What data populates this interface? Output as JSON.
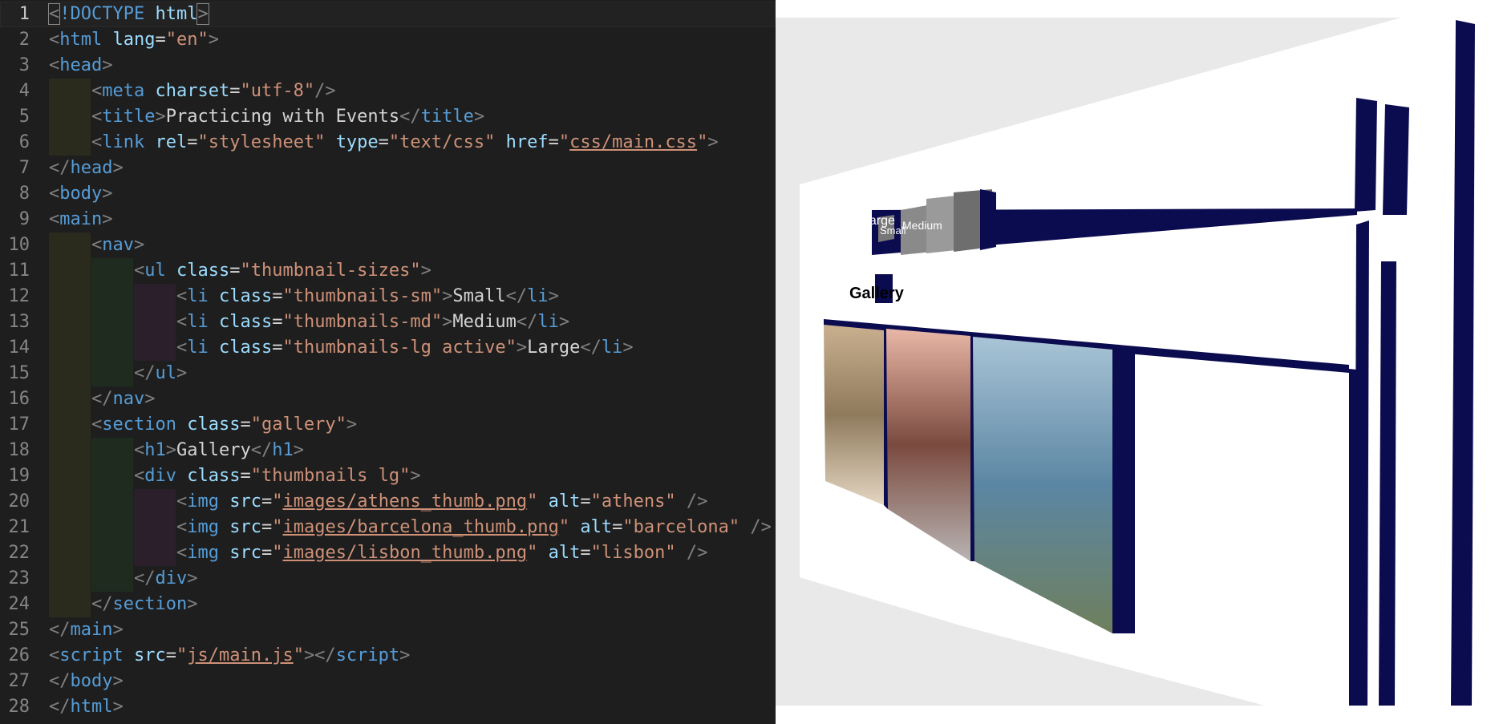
{
  "editor": {
    "current_line": 1,
    "lines": [
      {
        "n": "1",
        "indent": 0,
        "tokens": [
          [
            "br",
            "<"
          ],
          [
            "tag",
            "!DOCTYPE"
          ],
          [
            "text",
            " "
          ],
          [
            "attr",
            "html"
          ],
          [
            "br",
            ">"
          ]
        ]
      },
      {
        "n": "2",
        "indent": 0,
        "tokens": [
          [
            "br",
            "<"
          ],
          [
            "tag",
            "html"
          ],
          [
            "text",
            " "
          ],
          [
            "attr",
            "lang"
          ],
          [
            "eq",
            "="
          ],
          [
            "str",
            "\"en\""
          ],
          [
            "br",
            ">"
          ]
        ]
      },
      {
        "n": "3",
        "indent": 0,
        "tokens": [
          [
            "br",
            "<"
          ],
          [
            "tag",
            "head"
          ],
          [
            "br",
            ">"
          ]
        ]
      },
      {
        "n": "4",
        "indent": 1,
        "tokens": [
          [
            "br",
            "<"
          ],
          [
            "tag",
            "meta"
          ],
          [
            "text",
            " "
          ],
          [
            "attr",
            "charset"
          ],
          [
            "eq",
            "="
          ],
          [
            "str",
            "\"utf-8\""
          ],
          [
            "br",
            "/>"
          ]
        ]
      },
      {
        "n": "5",
        "indent": 1,
        "tokens": [
          [
            "br",
            "<"
          ],
          [
            "tag",
            "title"
          ],
          [
            "br",
            ">"
          ],
          [
            "text",
            "Practicing with Events"
          ],
          [
            "br",
            "</"
          ],
          [
            "tag",
            "title"
          ],
          [
            "br",
            ">"
          ]
        ]
      },
      {
        "n": "6",
        "indent": 1,
        "tokens": [
          [
            "br",
            "<"
          ],
          [
            "tag",
            "link"
          ],
          [
            "text",
            " "
          ],
          [
            "attr",
            "rel"
          ],
          [
            "eq",
            "="
          ],
          [
            "str",
            "\"stylesheet\""
          ],
          [
            "text",
            " "
          ],
          [
            "attr",
            "type"
          ],
          [
            "eq",
            "="
          ],
          [
            "str",
            "\"text/css\""
          ],
          [
            "text",
            " "
          ],
          [
            "attr",
            "href"
          ],
          [
            "eq",
            "="
          ],
          [
            "str",
            "\""
          ],
          [
            "link",
            "css/main.css"
          ],
          [
            "str",
            "\""
          ],
          [
            "br",
            ">"
          ]
        ]
      },
      {
        "n": "7",
        "indent": 0,
        "tokens": [
          [
            "br",
            "</"
          ],
          [
            "tag",
            "head"
          ],
          [
            "br",
            ">"
          ]
        ]
      },
      {
        "n": "8",
        "indent": 0,
        "tokens": [
          [
            "br",
            "<"
          ],
          [
            "tag",
            "body"
          ],
          [
            "br",
            ">"
          ]
        ]
      },
      {
        "n": "9",
        "indent": 0,
        "tokens": [
          [
            "br",
            "<"
          ],
          [
            "tag",
            "main"
          ],
          [
            "br",
            ">"
          ]
        ]
      },
      {
        "n": "10",
        "indent": 1,
        "tokens": [
          [
            "br",
            "<"
          ],
          [
            "tag",
            "nav"
          ],
          [
            "br",
            ">"
          ]
        ]
      },
      {
        "n": "11",
        "indent": 2,
        "tokens": [
          [
            "br",
            "<"
          ],
          [
            "tag",
            "ul"
          ],
          [
            "text",
            " "
          ],
          [
            "attr",
            "class"
          ],
          [
            "eq",
            "="
          ],
          [
            "str",
            "\"thumbnail-sizes\""
          ],
          [
            "br",
            ">"
          ]
        ]
      },
      {
        "n": "12",
        "indent": 3,
        "tokens": [
          [
            "br",
            "<"
          ],
          [
            "tag",
            "li"
          ],
          [
            "text",
            " "
          ],
          [
            "attr",
            "class"
          ],
          [
            "eq",
            "="
          ],
          [
            "str",
            "\"thumbnails-sm\""
          ],
          [
            "br",
            ">"
          ],
          [
            "text",
            "Small"
          ],
          [
            "br",
            "</"
          ],
          [
            "tag",
            "li"
          ],
          [
            "br",
            ">"
          ]
        ]
      },
      {
        "n": "13",
        "indent": 3,
        "tokens": [
          [
            "br",
            "<"
          ],
          [
            "tag",
            "li"
          ],
          [
            "text",
            " "
          ],
          [
            "attr",
            "class"
          ],
          [
            "eq",
            "="
          ],
          [
            "str",
            "\"thumbnails-md\""
          ],
          [
            "br",
            ">"
          ],
          [
            "text",
            "Medium"
          ],
          [
            "br",
            "</"
          ],
          [
            "tag",
            "li"
          ],
          [
            "br",
            ">"
          ]
        ]
      },
      {
        "n": "14",
        "indent": 3,
        "tokens": [
          [
            "br",
            "<"
          ],
          [
            "tag",
            "li"
          ],
          [
            "text",
            " "
          ],
          [
            "attr",
            "class"
          ],
          [
            "eq",
            "="
          ],
          [
            "str",
            "\"thumbnails-lg active\""
          ],
          [
            "br",
            ">"
          ],
          [
            "text",
            "Large"
          ],
          [
            "br",
            "</"
          ],
          [
            "tag",
            "li"
          ],
          [
            "br",
            ">"
          ]
        ]
      },
      {
        "n": "15",
        "indent": 2,
        "tokens": [
          [
            "br",
            "</"
          ],
          [
            "tag",
            "ul"
          ],
          [
            "br",
            ">"
          ]
        ]
      },
      {
        "n": "16",
        "indent": 1,
        "tokens": [
          [
            "br",
            "</"
          ],
          [
            "tag",
            "nav"
          ],
          [
            "br",
            ">"
          ]
        ]
      },
      {
        "n": "17",
        "indent": 1,
        "tokens": [
          [
            "br",
            "<"
          ],
          [
            "tag",
            "section"
          ],
          [
            "text",
            " "
          ],
          [
            "attr",
            "class"
          ],
          [
            "eq",
            "="
          ],
          [
            "str",
            "\"gallery\""
          ],
          [
            "br",
            ">"
          ]
        ]
      },
      {
        "n": "18",
        "indent": 2,
        "tokens": [
          [
            "br",
            "<"
          ],
          [
            "tag",
            "h1"
          ],
          [
            "br",
            ">"
          ],
          [
            "text",
            "Gallery"
          ],
          [
            "br",
            "</"
          ],
          [
            "tag",
            "h1"
          ],
          [
            "br",
            ">"
          ]
        ]
      },
      {
        "n": "19",
        "indent": 2,
        "tokens": [
          [
            "br",
            "<"
          ],
          [
            "tag",
            "div"
          ],
          [
            "text",
            " "
          ],
          [
            "attr",
            "class"
          ],
          [
            "eq",
            "="
          ],
          [
            "str",
            "\"thumbnails lg\""
          ],
          [
            "br",
            ">"
          ]
        ]
      },
      {
        "n": "20",
        "indent": 3,
        "tokens": [
          [
            "br",
            "<"
          ],
          [
            "tag",
            "img"
          ],
          [
            "text",
            " "
          ],
          [
            "attr",
            "src"
          ],
          [
            "eq",
            "="
          ],
          [
            "str",
            "\""
          ],
          [
            "link",
            "images/athens_thumb.png"
          ],
          [
            "str",
            "\""
          ],
          [
            "text",
            " "
          ],
          [
            "attr",
            "alt"
          ],
          [
            "eq",
            "="
          ],
          [
            "str",
            "\"athens\""
          ],
          [
            "text",
            " "
          ],
          [
            "br",
            "/>"
          ]
        ]
      },
      {
        "n": "21",
        "indent": 3,
        "tokens": [
          [
            "br",
            "<"
          ],
          [
            "tag",
            "img"
          ],
          [
            "text",
            " "
          ],
          [
            "attr",
            "src"
          ],
          [
            "eq",
            "="
          ],
          [
            "str",
            "\""
          ],
          [
            "link",
            "images/barcelona_thumb.png"
          ],
          [
            "str",
            "\""
          ],
          [
            "text",
            " "
          ],
          [
            "attr",
            "alt"
          ],
          [
            "eq",
            "="
          ],
          [
            "str",
            "\"barcelona\""
          ],
          [
            "text",
            " "
          ],
          [
            "br",
            "/>"
          ]
        ]
      },
      {
        "n": "22",
        "indent": 3,
        "tokens": [
          [
            "br",
            "<"
          ],
          [
            "tag",
            "img"
          ],
          [
            "text",
            " "
          ],
          [
            "attr",
            "src"
          ],
          [
            "eq",
            "="
          ],
          [
            "str",
            "\""
          ],
          [
            "link",
            "images/lisbon_thumb.png"
          ],
          [
            "str",
            "\""
          ],
          [
            "text",
            " "
          ],
          [
            "attr",
            "alt"
          ],
          [
            "eq",
            "="
          ],
          [
            "str",
            "\"lisbon\""
          ],
          [
            "text",
            " "
          ],
          [
            "br",
            "/>"
          ]
        ]
      },
      {
        "n": "23",
        "indent": 2,
        "tokens": [
          [
            "br",
            "</"
          ],
          [
            "tag",
            "div"
          ],
          [
            "br",
            ">"
          ]
        ]
      },
      {
        "n": "24",
        "indent": 1,
        "tokens": [
          [
            "br",
            "</"
          ],
          [
            "tag",
            "section"
          ],
          [
            "br",
            ">"
          ]
        ]
      },
      {
        "n": "25",
        "indent": 0,
        "tokens": [
          [
            "br",
            "</"
          ],
          [
            "tag",
            "main"
          ],
          [
            "br",
            ">"
          ]
        ]
      },
      {
        "n": "26",
        "indent": 0,
        "tokens": [
          [
            "br",
            "<"
          ],
          [
            "tag",
            "script"
          ],
          [
            "text",
            " "
          ],
          [
            "attr",
            "src"
          ],
          [
            "eq",
            "="
          ],
          [
            "str",
            "\""
          ],
          [
            "link",
            "js/main.js"
          ],
          [
            "str",
            "\""
          ],
          [
            "br",
            "></"
          ],
          [
            "tag",
            "script"
          ],
          [
            "br",
            ">"
          ]
        ]
      },
      {
        "n": "27",
        "indent": 0,
        "tokens": [
          [
            "br",
            "</"
          ],
          [
            "tag",
            "body"
          ],
          [
            "br",
            ">"
          ]
        ]
      },
      {
        "n": "28",
        "indent": 0,
        "tokens": [
          [
            "br",
            "</"
          ],
          [
            "tag",
            "html"
          ],
          [
            "br",
            ">"
          ]
        ]
      }
    ]
  },
  "preview": {
    "nav_labels": [
      "Small",
      "Medium",
      "Large"
    ],
    "heading": "Gallery",
    "accent_color": "#0b0b4f",
    "photos": [
      {
        "name": "athens",
        "colors": [
          "#c9b08f",
          "#8f7a5c",
          "#e4d6c2"
        ]
      },
      {
        "name": "barcelona",
        "colors": [
          "#e9b7a6",
          "#7b4a3f",
          "#b8b4b2"
        ]
      },
      {
        "name": "lisbon",
        "colors": [
          "#a9c4d6",
          "#5b86a3",
          "#6e7f5c"
        ]
      }
    ]
  }
}
